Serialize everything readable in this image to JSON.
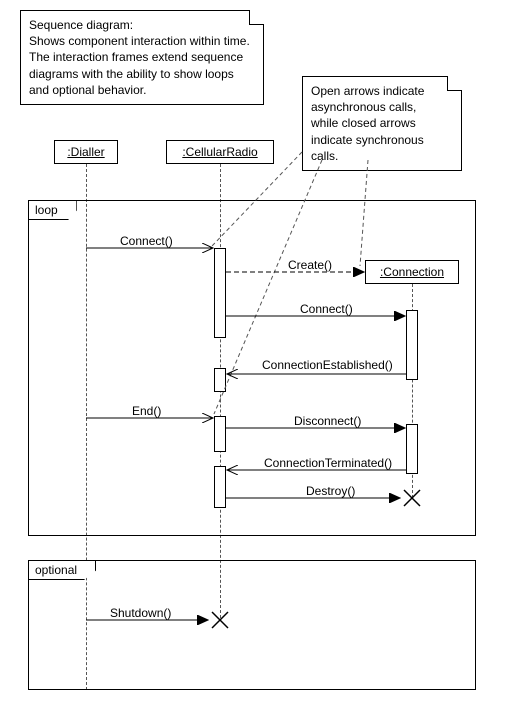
{
  "notes": {
    "description": "Sequence diagram:\nShows component interaction within time.\nThe interaction frames extend sequence\ndiagrams with the ability to show loops\nand optional behavior.",
    "arrows": "Open arrows indicate\nasynchronous calls,\nwhile closed arrows\nindicate synchronous\ncalls."
  },
  "lifelines": {
    "dialler": ":Dialler",
    "cellular_radio": ":CellularRadio",
    "connection": ":Connection"
  },
  "frames": {
    "loop": "loop",
    "optional": "optional"
  },
  "messages": {
    "connect_call": "Connect()",
    "create": "Create()",
    "connect2": "Connect()",
    "conn_established": "ConnectionEstablished()",
    "end": "End()",
    "disconnect": "Disconnect()",
    "conn_terminated": "ConnectionTerminated()",
    "destroy": "Destroy()",
    "shutdown": "Shutdown()"
  },
  "diagram_meta": {
    "type": "UML Sequence Diagram",
    "participants": [
      "Dialler",
      "CellularRadio",
      "Connection"
    ],
    "fragments": [
      "loop",
      "optional"
    ],
    "sequence": [
      {
        "from": "Dialler",
        "to": "CellularRadio",
        "label": "Connect()",
        "kind": "async",
        "in": "loop"
      },
      {
        "from": "CellularRadio",
        "to": "Connection",
        "label": "Create()",
        "kind": "sync",
        "in": "loop",
        "creates": true
      },
      {
        "from": "CellularRadio",
        "to": "Connection",
        "label": "Connect()",
        "kind": "sync",
        "in": "loop"
      },
      {
        "from": "Connection",
        "to": "CellularRadio",
        "label": "ConnectionEstablished()",
        "kind": "async",
        "in": "loop"
      },
      {
        "from": "Dialler",
        "to": "CellularRadio",
        "label": "End()",
        "kind": "async",
        "in": "loop"
      },
      {
        "from": "CellularRadio",
        "to": "Connection",
        "label": "Disconnect()",
        "kind": "sync",
        "in": "loop"
      },
      {
        "from": "Connection",
        "to": "CellularRadio",
        "label": "ConnectionTerminated()",
        "kind": "async",
        "in": "loop"
      },
      {
        "from": "CellularRadio",
        "to": "Connection",
        "label": "Destroy()",
        "kind": "sync",
        "in": "loop",
        "destroys": true
      },
      {
        "from": "Dialler",
        "to": "CellularRadio",
        "label": "Shutdown()",
        "kind": "sync",
        "in": "optional",
        "destroys": true
      }
    ]
  }
}
